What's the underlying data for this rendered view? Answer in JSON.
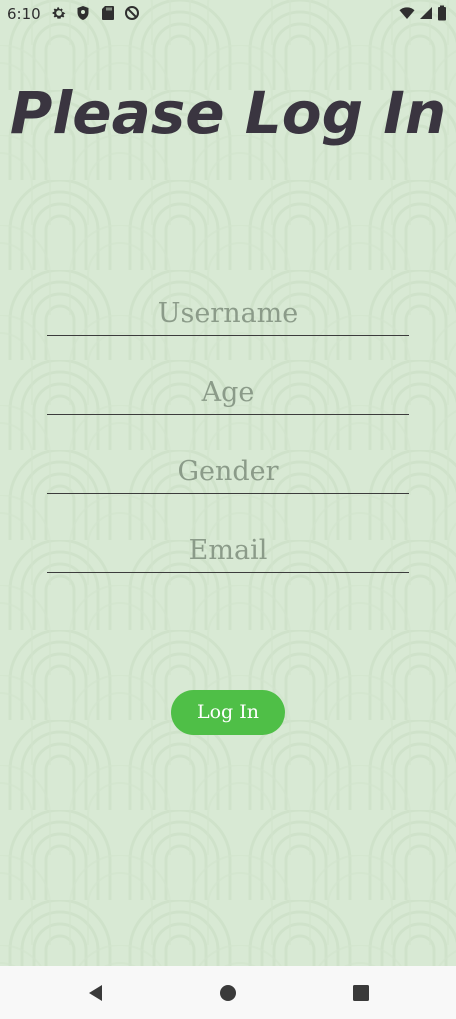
{
  "status_bar": {
    "time": "6:10",
    "left_icons": [
      "gear-icon",
      "shield-icon",
      "sd-card-icon",
      "no-sync-icon"
    ],
    "right_icons": [
      "wifi-icon",
      "signal-icon",
      "battery-icon"
    ]
  },
  "title": "Please Log In",
  "form": {
    "username_placeholder": "Username",
    "age_placeholder": "Age",
    "gender_placeholder": "Gender",
    "email_placeholder": "Email",
    "username_value": "",
    "age_value": "",
    "gender_value": "",
    "email_value": ""
  },
  "login_button_label": "Log In",
  "nav_bar": {
    "buttons": [
      "back-icon",
      "home-icon",
      "recents-icon"
    ]
  },
  "colors": {
    "background": "#d8e9d4",
    "title": "#3a3540",
    "button": "#4fbf47",
    "placeholder": "#8b9b89",
    "underline": "#3c3c3c"
  }
}
